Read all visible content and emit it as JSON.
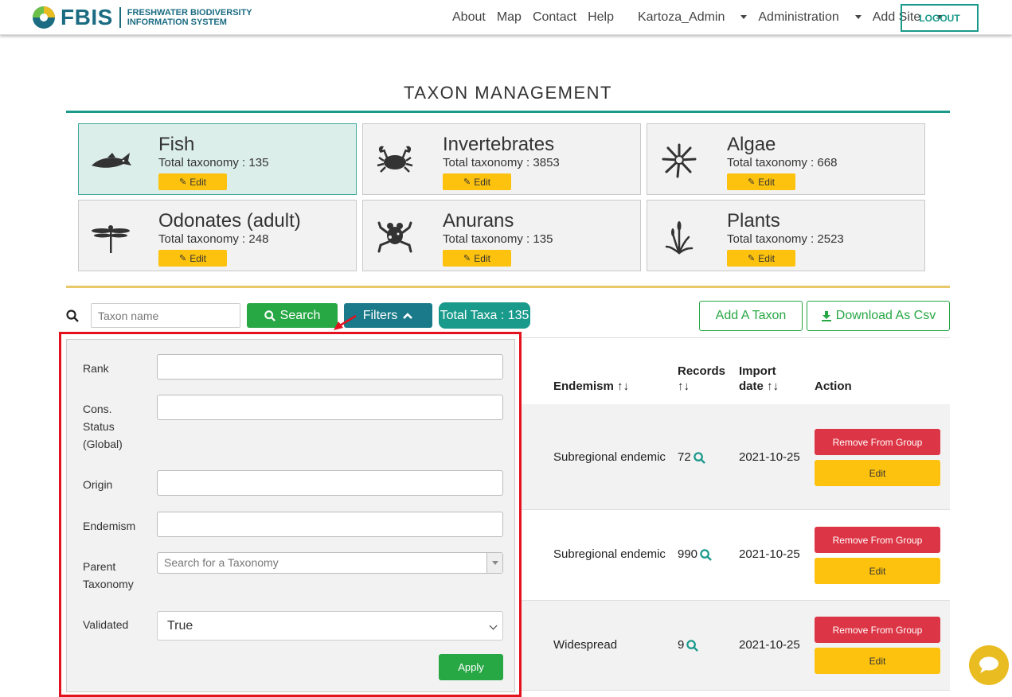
{
  "brand": {
    "name": "FBIS",
    "subtitle_line1": "FRESHWATER BIODIVERSITY",
    "subtitle_line2": "INFORMATION SYSTEM"
  },
  "nav": {
    "about": "About",
    "map": "Map",
    "contact": "Contact",
    "help": "Help",
    "user": "Kartoza_Admin",
    "administration": "Administration",
    "add_site": "Add Site",
    "logout": "LOGOUT"
  },
  "page": {
    "title": "TAXON MANAGEMENT"
  },
  "groups": [
    {
      "name": "Fish",
      "total": "Total taxonomy : 135",
      "edit": "Edit",
      "icon": "fish-icon"
    },
    {
      "name": "Invertebrates",
      "total": "Total taxonomy : 3853",
      "edit": "Edit",
      "icon": "crab-icon"
    },
    {
      "name": "Algae",
      "total": "Total taxonomy : 668",
      "edit": "Edit",
      "icon": "algae-icon"
    },
    {
      "name": "Odonates (adult)",
      "total": "Total taxonomy : 248",
      "edit": "Edit",
      "icon": "dragonfly-icon"
    },
    {
      "name": "Anurans",
      "total": "Total taxonomy : 135",
      "edit": "Edit",
      "icon": "frog-icon"
    },
    {
      "name": "Plants",
      "total": "Total taxonomy : 2523",
      "edit": "Edit",
      "icon": "plant-icon"
    }
  ],
  "toolbar": {
    "search_placeholder": "Taxon name",
    "search_label": "Search",
    "filters_label": "Filters",
    "total_taxa": "Total Taxa : 135",
    "add_taxon": "Add A Taxon",
    "download_csv": "Download As Csv"
  },
  "table": {
    "headers": {
      "endemism": "Endemism",
      "records_line1": "Records",
      "import_line1": "Import",
      "import_line2": "date",
      "action": "Action"
    },
    "rows": [
      {
        "endemism": "Subregional endemic",
        "records": "72",
        "import_date": "2021-10-25",
        "remove": "Remove From Group",
        "edit": "Edit"
      },
      {
        "endemism": "Subregional endemic",
        "records": "990",
        "import_date": "2021-10-25",
        "remove": "Remove From Group",
        "edit": "Edit"
      },
      {
        "endemism": "Widespread",
        "records": "9",
        "import_date": "2021-10-25",
        "remove": "Remove From Group",
        "edit": "Edit"
      }
    ]
  },
  "filters": {
    "rank_label": "Rank",
    "cons_status_line1": "Cons.",
    "cons_status_line2": "Status",
    "cons_status_line3": "(Global)",
    "origin_label": "Origin",
    "endemism_label": "Endemism",
    "parent_line1": "Parent",
    "parent_line2": "Taxonomy",
    "parent_placeholder": "Search for a Taxonomy",
    "validated_label": "Validated",
    "validated_value": "True",
    "apply": "Apply"
  },
  "colors": {
    "teal": "#1a9a8b",
    "green": "#28a745",
    "yellow": "#fdc20e",
    "red": "#dc3545",
    "highlight_red": "#e3121e"
  }
}
